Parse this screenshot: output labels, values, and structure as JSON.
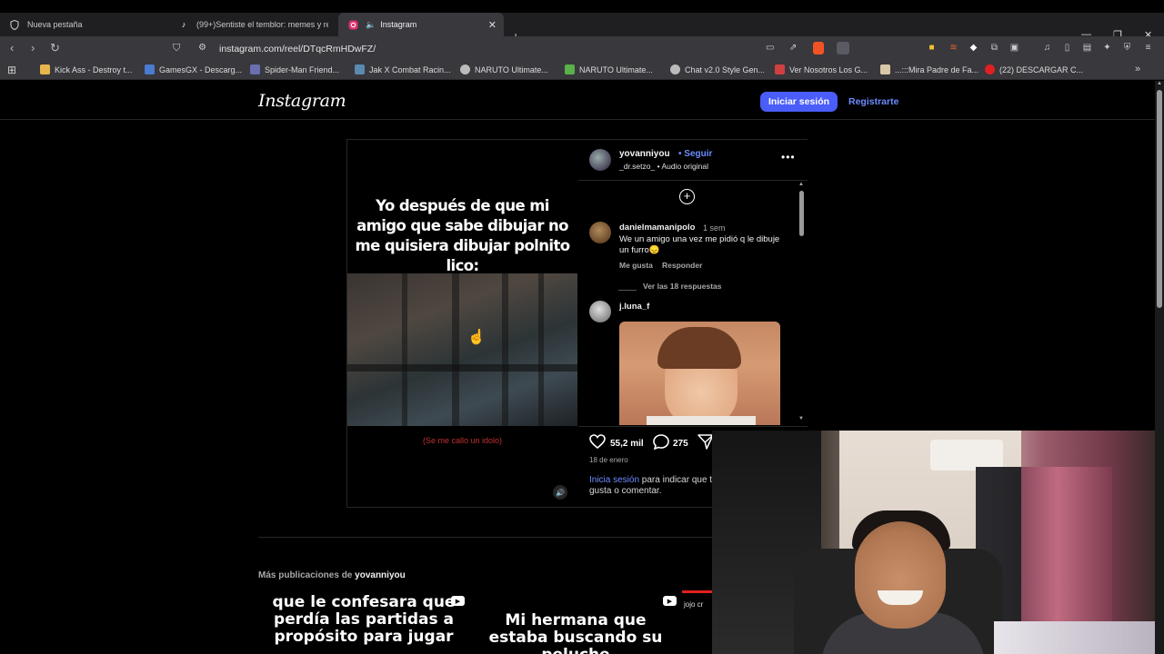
{
  "browser": {
    "tabs": [
      {
        "label": "Nueva pestaña",
        "icon": "shield-icon"
      },
      {
        "label": "(99+)Sentiste el temblor: memes y re",
        "icon": "tiktok-icon"
      },
      {
        "label": "Instagram",
        "icon": "instagram-icon",
        "active": true
      }
    ],
    "url": "instagram.com/reel/DTqcRmHDwFZ/",
    "bookmarks": [
      {
        "label": "Kick Ass - Destroy t...",
        "color": "#e8b64c"
      },
      {
        "label": "GamesGX - Descarg...",
        "color": "#4a7bd0"
      },
      {
        "label": "Spider-Man Friend...",
        "color": "#6a6fb0"
      },
      {
        "label": "Jak X Combat Racin...",
        "color": "#5a8ab0"
      },
      {
        "label": "NARUTO Ultimate...",
        "color": "#bbbbbb"
      },
      {
        "label": "NARUTO Ultimate...",
        "color": "#5ab04a"
      },
      {
        "label": "Chat v2.0 Style Gen...",
        "color": "#bbbbbb"
      },
      {
        "label": "Ver Nosotros Los G...",
        "color": "#d04040"
      },
      {
        "label": "...:::Mira Padre de Fa...",
        "color": "#d8c8a8"
      },
      {
        "label": "(22) DESCARGAR C...",
        "color": "#e02020"
      }
    ]
  },
  "instagram": {
    "logo": "Instagram",
    "login_button": "Iniciar sesión",
    "signup_link": "Registrarte",
    "post": {
      "caption_overlay": "Yo después de que mi amigo que sabe dibujar no me quisiera dibujar polnito lico:",
      "subtitle": "(Se me callo un idolo)",
      "author": "yovanniyou",
      "follow": "• Seguir",
      "audio": "_dr.setzo_ • Audio original",
      "comments": [
        {
          "user": "danielmamanipolo",
          "time": "1 sem",
          "text": "We un amigo una vez me pidió q le dibuje un furro😞",
          "like_label": "Me gusta",
          "reply_label": "Responder",
          "view_replies": "Ver las 18 respuestas"
        },
        {
          "user": "j.luna_f"
        }
      ],
      "likes": "55,2 mil",
      "comment_count": "275",
      "date": "18 de enero",
      "login_prompt_link": "Inicia sesión",
      "login_prompt_rest": " para indicar que te gusta o comentar."
    },
    "more_posts_prefix": "Más publicaciones de ",
    "more_posts_user": "yovanniyou",
    "thumbnails": [
      {
        "text": "que le confesara que perdía las partidas a propósito para jugar"
      },
      {
        "text": "Mi hermana que estaba buscando su peluche"
      },
      {
        "text": "jojo cr"
      }
    ]
  },
  "colors": {
    "accent": "#4a5df9",
    "link": "#6d8cff",
    "subtitle_red": "#c03030"
  }
}
